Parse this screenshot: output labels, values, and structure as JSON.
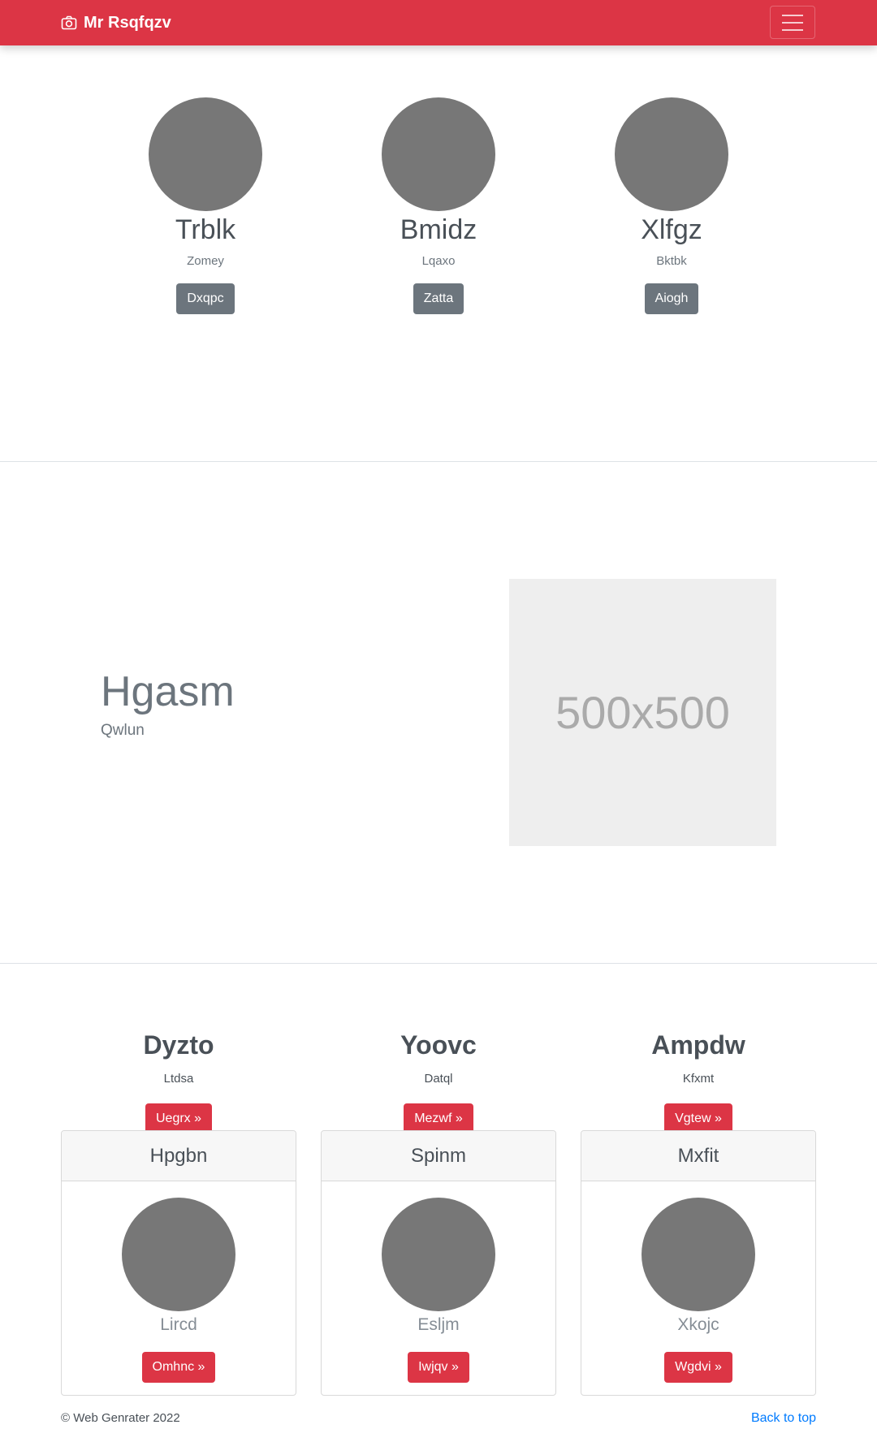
{
  "navbar": {
    "brand": "Mr Rsqfqzv",
    "brand_icon": "camera-icon",
    "toggler_icon": "hamburger-icon"
  },
  "profiles": [
    {
      "name": "Trblk",
      "subtitle": "Zomey",
      "button": "Dxqpc"
    },
    {
      "name": "Bmidz",
      "subtitle": "Lqaxo",
      "button": "Zatta"
    },
    {
      "name": "Xlfgz",
      "subtitle": "Bktbk",
      "button": "Aiogh"
    }
  ],
  "feature": {
    "title": "Hgasm",
    "subtitle": "Qwlun",
    "image_text": "500x500"
  },
  "columns": [
    {
      "title": "Dyzto",
      "subtitle": "Ltdsa",
      "button": "Uegrx »"
    },
    {
      "title": "Yoovc",
      "subtitle": "Datql",
      "button": "Mezwf »"
    },
    {
      "title": "Ampdw",
      "subtitle": "Kfxmt",
      "button": "Vgtew »"
    }
  ],
  "cards": [
    {
      "header": "Hpgbn",
      "caption": "Lircd",
      "button": "Omhnc »"
    },
    {
      "header": "Spinm",
      "caption": "Esljm",
      "button": "Iwjqv »"
    },
    {
      "header": "Mxfit",
      "caption": "Xkojc",
      "button": "Wgdvi »"
    }
  ],
  "footer": {
    "copyright": "© Web Genrater 2022",
    "back_to_top": "Back to top"
  },
  "colors": {
    "primary": "#dc3545",
    "secondary": "#6c757d",
    "avatar": "#777777",
    "link": "#007bff"
  }
}
